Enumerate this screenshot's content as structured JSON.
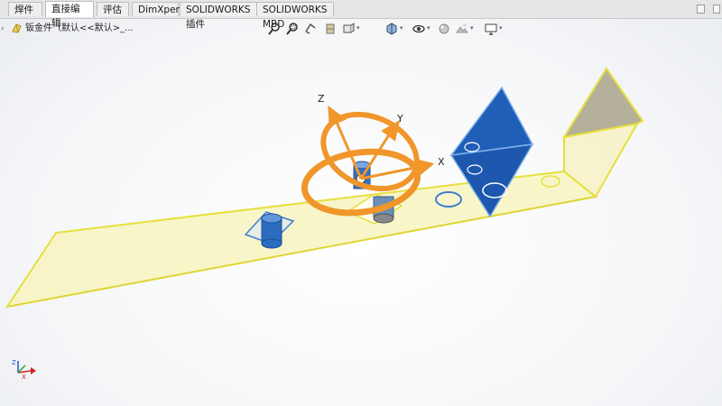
{
  "tabs": [
    {
      "label": "焊件",
      "active": false
    },
    {
      "label": "直接编辑",
      "active": true
    },
    {
      "label": "评估",
      "active": false
    },
    {
      "label": "DimXpert",
      "active": false
    },
    {
      "label": "SOLIDWORKS 插件",
      "active": false
    },
    {
      "label": "SOLIDWORKS MBD",
      "active": false
    }
  ],
  "feature_tree": {
    "part_label": "钣金件（默认<<默认>_..."
  },
  "view_toolbar": {
    "icons": [
      "zoom-to-fit-icon",
      "zoom-to-area-icon",
      "previous-view-icon",
      "section-view-icon",
      "view-orientation-icon",
      "display-style-icon",
      "hide-show-items-icon",
      "edit-appearance-icon",
      "apply-scene-icon",
      "view-settings-icon"
    ]
  },
  "triad": {
    "x_label": "X",
    "y_label": "Y",
    "z_label": "Z"
  },
  "colors": {
    "part_fill": "#f6f3b8",
    "part_edge": "#e8df3c",
    "selected_face": "#1f5fb8",
    "triad_orange": "#f0962a",
    "hole_blue": "#3d7fd0"
  }
}
